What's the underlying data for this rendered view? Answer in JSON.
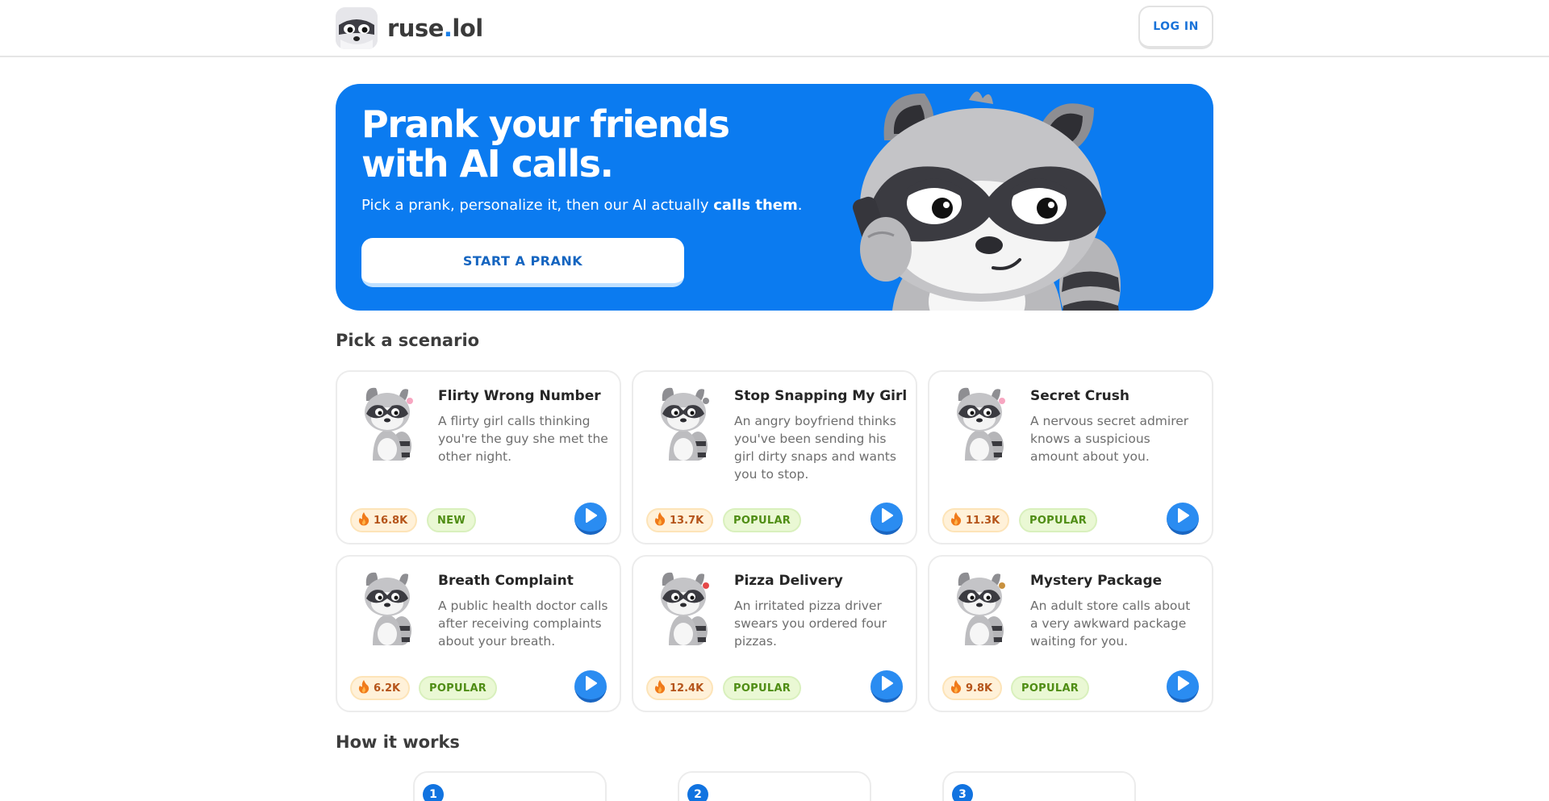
{
  "header": {
    "logo_name": "ruse",
    "logo_dot": ".",
    "logo_tld": "lol",
    "login_label": "LOG IN"
  },
  "hero": {
    "title_line1": "Prank your friends",
    "title_line2": "with AI calls.",
    "subtitle_start": "Pick a prank, personalize it, then our AI actually ",
    "subtitle_bold": "calls them",
    "subtitle_end": ".",
    "cta_label": "START A PRANK"
  },
  "scenarios": {
    "heading": "Pick a scenario",
    "items": [
      {
        "title": "Flirty Wrong Number",
        "description": "A flirty girl calls thinking you're the guy she met the other night.",
        "plays": "16.8K",
        "badge": "NEW"
      },
      {
        "title": "Stop Snapping My Girl",
        "description": "An angry boyfriend thinks you've been sending his girl dirty snaps and wants you to stop.",
        "plays": "13.7K",
        "badge": "POPULAR"
      },
      {
        "title": "Secret Crush",
        "description": "A nervous secret admirer knows a suspicious amount about you.",
        "plays": "11.3K",
        "badge": "POPULAR"
      },
      {
        "title": "Breath Complaint",
        "description": "A public health doctor calls after receiving complaints about your breath.",
        "plays": "6.2K",
        "badge": "POPULAR"
      },
      {
        "title": "Pizza Delivery",
        "description": "An irritated pizza driver swears you ordered four pizzas.",
        "plays": "12.4K",
        "badge": "POPULAR"
      },
      {
        "title": "Mystery Package",
        "description": "An adult store calls about a very awkward package waiting for you.",
        "plays": "9.8K",
        "badge": "POPULAR"
      }
    ]
  },
  "how_it_works": {
    "heading": "How it works",
    "steps": [
      "1",
      "2",
      "3"
    ]
  },
  "colors": {
    "brand_blue": "#0b7bf0",
    "play_blue": "#2a8cf1",
    "badge_green": "#4f8d14",
    "stat_orange": "#b5541a"
  },
  "icons": [
    "raccoon-logo-icon",
    "raccoon-mascot-icon",
    "fire-icon",
    "play-icon"
  ]
}
